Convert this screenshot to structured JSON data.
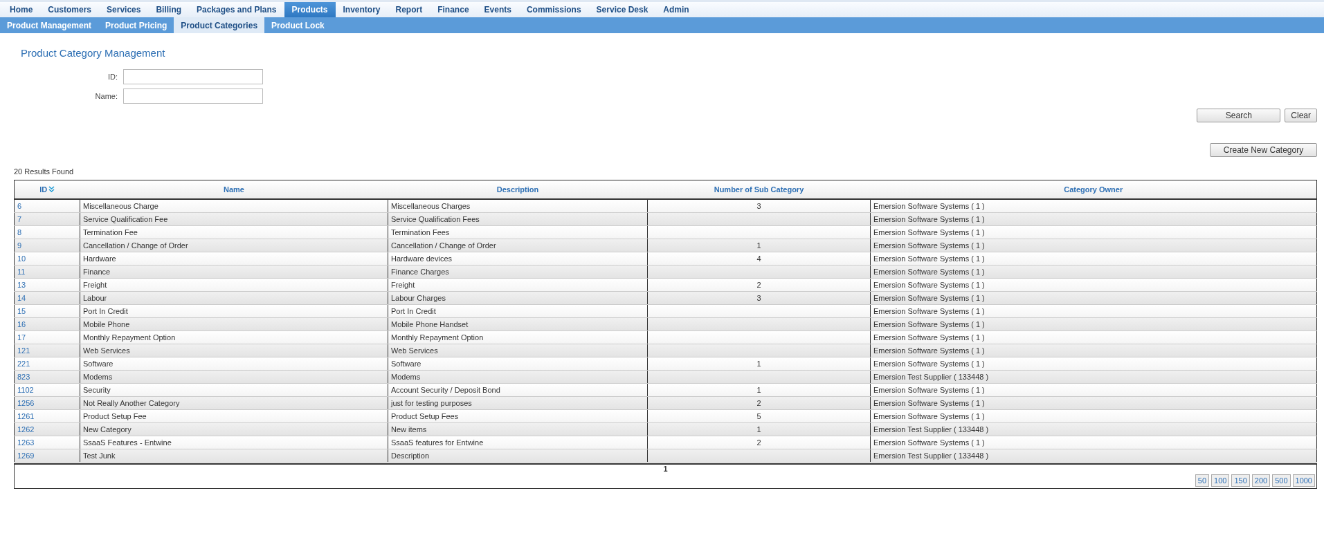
{
  "main_nav": [
    {
      "label": "Home",
      "selected": false
    },
    {
      "label": "Customers",
      "selected": false
    },
    {
      "label": "Services",
      "selected": false
    },
    {
      "label": "Billing",
      "selected": false
    },
    {
      "label": "Packages and Plans",
      "selected": false
    },
    {
      "label": "Products",
      "selected": true
    },
    {
      "label": "Inventory",
      "selected": false
    },
    {
      "label": "Report",
      "selected": false
    },
    {
      "label": "Finance",
      "selected": false
    },
    {
      "label": "Events",
      "selected": false
    },
    {
      "label": "Commissions",
      "selected": false
    },
    {
      "label": "Service Desk",
      "selected": false
    },
    {
      "label": "Admin",
      "selected": false
    }
  ],
  "sub_nav": [
    {
      "label": "Product Management",
      "selected": false
    },
    {
      "label": "Product Pricing",
      "selected": false
    },
    {
      "label": "Product Categories",
      "selected": true
    },
    {
      "label": "Product Lock",
      "selected": false
    }
  ],
  "page_title": "Product Category Management",
  "search_form": {
    "fields": [
      {
        "label": "ID:"
      },
      {
        "label": "Name:"
      }
    ],
    "buttons": [
      "Search",
      "Clear"
    ]
  },
  "create_button": "Create New Category",
  "results_count": "20 Results Found",
  "table": {
    "columns": [
      "ID",
      "Name",
      "Description",
      "Number of Sub Category",
      "Category Owner"
    ],
    "rows": [
      {
        "id": "6",
        "name": "Miscellaneous Charge",
        "description": "Miscellaneous Charges",
        "sub_categories": "3",
        "owner": "Emersion Software Systems ( 1 )"
      },
      {
        "id": "7",
        "name": "Service Qualification Fee",
        "description": "Service Qualification Fees",
        "owner": "Emersion Software Systems ( 1 )"
      },
      {
        "id": "8",
        "name": "Termination Fee",
        "description": "Termination Fees",
        "owner": "Emersion Software Systems ( 1 )"
      },
      {
        "id": "9",
        "name": "Cancellation / Change of Order",
        "description": "Cancellation / Change of Order",
        "sub_categories": "1",
        "owner": "Emersion Software Systems ( 1 )"
      },
      {
        "id": "10",
        "name": "Hardware",
        "description": "Hardware devices",
        "sub_categories": "4",
        "owner": "Emersion Software Systems ( 1 )"
      },
      {
        "id": "11",
        "name": "Finance",
        "description": "Finance Charges",
        "owner": "Emersion Software Systems ( 1 )"
      },
      {
        "id": "13",
        "name": "Freight",
        "description": "Freight",
        "sub_categories": "2",
        "owner": "Emersion Software Systems ( 1 )"
      },
      {
        "id": "14",
        "name": "Labour",
        "description": "Labour Charges",
        "sub_categories": "3",
        "owner": "Emersion Software Systems ( 1 )"
      },
      {
        "id": "15",
        "name": "Port In Credit",
        "description": "Port In Credit",
        "owner": "Emersion Software Systems ( 1 )"
      },
      {
        "id": "16",
        "name": "Mobile Phone",
        "description": "Mobile Phone Handset",
        "owner": "Emersion Software Systems ( 1 )"
      },
      {
        "id": "17",
        "name": "Monthly Repayment Option",
        "description": "Monthly Repayment Option",
        "owner": "Emersion Software Systems ( 1 )"
      },
      {
        "id": "121",
        "name": "Web Services",
        "description": "Web Services",
        "owner": "Emersion Software Systems ( 1 )"
      },
      {
        "id": "221",
        "name": "Software",
        "description": "Software",
        "sub_categories": "1",
        "owner": "Emersion Software Systems ( 1 )"
      },
      {
        "id": "823",
        "name": "Modems",
        "description": "Modems",
        "owner": "Emersion Test Supplier ( 133448 )"
      },
      {
        "id": "1102",
        "name": "Security",
        "description": "Account Security / Deposit Bond",
        "sub_categories": "1",
        "owner": "Emersion Software Systems ( 1 )"
      },
      {
        "id": "1256",
        "name": "Not Really Another Category",
        "description": "just for testing purposes",
        "sub_categories": "2",
        "owner": "Emersion Software Systems ( 1 )"
      },
      {
        "id": "1261",
        "name": "Product Setup Fee",
        "description": "Product Setup Fees",
        "sub_categories": "5",
        "owner": "Emersion Software Systems ( 1 )"
      },
      {
        "id": "1262",
        "name": "New Category",
        "description": "New items",
        "sub_categories": "1",
        "owner": "Emersion Test Supplier ( 133448 )"
      },
      {
        "id": "1263",
        "name": "SsaaS Features - Entwine",
        "description": "SsaaS features for Entwine",
        "sub_categories": "2",
        "owner": "Emersion Software Systems ( 1 )"
      },
      {
        "id": "1269",
        "name": "Test Junk",
        "description": "Description",
        "owner": "Emersion Test Supplier ( 133448 )"
      }
    ]
  },
  "pagination": {
    "pages": [
      {
        "label": "1",
        "selected": true
      }
    ],
    "page_sizes": [
      "50",
      "100",
      "150",
      "200",
      "500",
      "1000"
    ]
  }
}
